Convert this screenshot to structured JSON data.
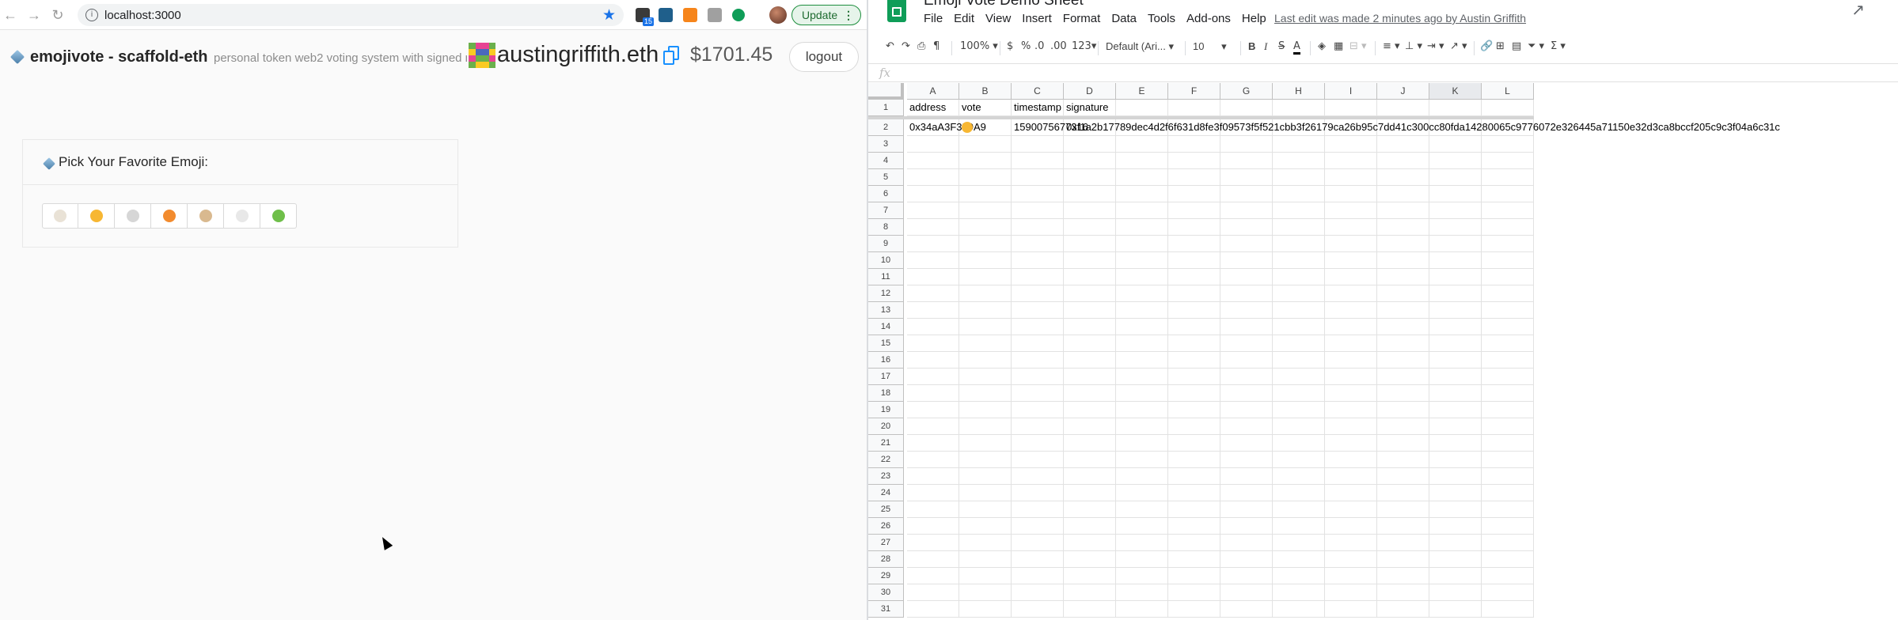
{
  "browser": {
    "url": "localhost:3000",
    "extension_badge": "15",
    "update_label": "Update"
  },
  "app": {
    "title": "emojivote - scaffold-eth",
    "subtitle": "personal token web2 voting system with signed messages",
    "ens_name": "austingriffith.eth",
    "balance": "$1701.45",
    "logout_label": "logout",
    "card_title": "Pick Your Favorite Emoji:",
    "emojis": [
      {
        "name": "cat-face",
        "color": "#e9e2d6"
      },
      {
        "name": "smiling-face-with-sunglasses",
        "color": "#f7b733"
      },
      {
        "name": "mouse-face",
        "color": "#d6d6d6"
      },
      {
        "name": "fox-face",
        "color": "#f28b2e"
      },
      {
        "name": "dog-face",
        "color": "#d9b98f"
      },
      {
        "name": "rabbit-face",
        "color": "#e8e8e8"
      },
      {
        "name": "frog-face",
        "color": "#6fbf4a"
      }
    ]
  },
  "sheets": {
    "doc_title": "Emoji Vote Demo Sheet",
    "menu": [
      "File",
      "Edit",
      "View",
      "Insert",
      "Format",
      "Data",
      "Tools",
      "Add-ons",
      "Help"
    ],
    "last_edit": "Last edit was made 2 minutes ago by Austin Griffith",
    "toolbar": {
      "zoom": "100%",
      "currency": "$",
      "percent": "%",
      "dec_minus": ".0",
      "dec_plus": ".00",
      "number_format": "123",
      "font": "Default (Ari...",
      "font_size": "10"
    },
    "formula_label": "fx",
    "columns": [
      "A",
      "B",
      "C",
      "D",
      "E",
      "F",
      "G",
      "H",
      "I",
      "J",
      "K",
      "L"
    ],
    "selected_column": "K",
    "rows": [
      "1",
      "2",
      "3",
      "4",
      "5",
      "6",
      "7",
      "8",
      "9",
      "10",
      "11",
      "12",
      "13",
      "14",
      "15",
      "16",
      "17",
      "18",
      "19",
      "20",
      "21",
      "22",
      "23",
      "24",
      "25",
      "26",
      "27",
      "28",
      "29",
      "30",
      "31"
    ],
    "header_row": [
      "address",
      "vote",
      "timestamp",
      "signature"
    ],
    "data_row": {
      "address": "0x34aA3F359A9",
      "vote_emoji": "smiling-face-with-sunglasses",
      "timestamp": "1590075677316",
      "signature": "0xf1a2b17789dec4d2f6f631d8fe3f09573f5f521cbb3f26179ca26b95c7dd41c300cc80fda14280065c9776072e326445a71150e32d3ca8bccf205c9c3f04a6c31c"
    }
  }
}
